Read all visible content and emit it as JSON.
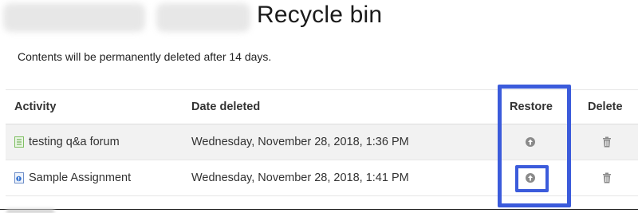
{
  "header": {
    "title": "Recycle bin"
  },
  "notice": "Contents will be permanently deleted after 14 days.",
  "table": {
    "columns": {
      "activity": "Activity",
      "date_deleted": "Date deleted",
      "restore": "Restore",
      "delete": "Delete"
    },
    "rows": [
      {
        "activity": "testing q&a forum",
        "icon": "forum-icon",
        "date_deleted": "Wednesday, November 28, 2018, 1:36 PM"
      },
      {
        "activity": "Sample Assignment",
        "icon": "assignment-icon",
        "date_deleted": "Wednesday, November 28, 2018, 1:41 PM"
      }
    ]
  },
  "colors": {
    "highlight": "#3b5bdb",
    "stripe": "#f2f2f2"
  }
}
